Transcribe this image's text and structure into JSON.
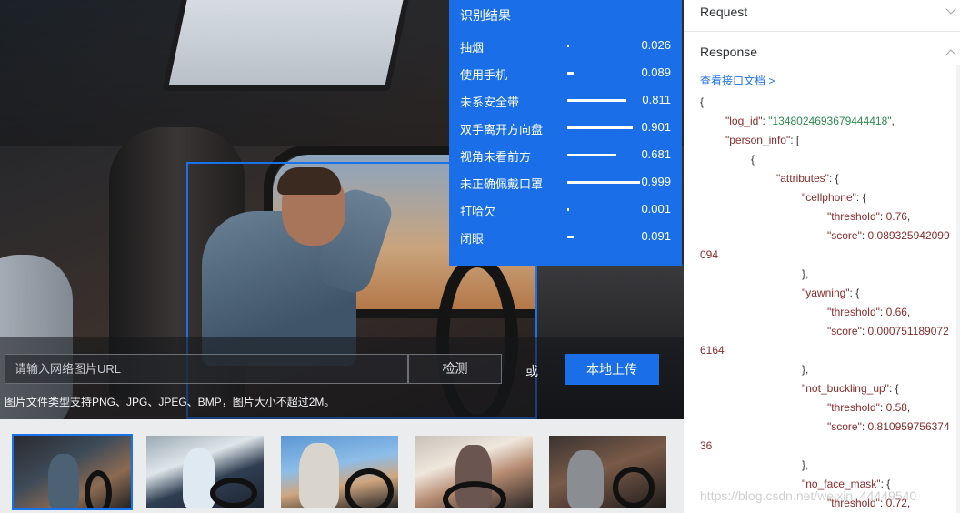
{
  "left": {
    "results": {
      "title": "识别结果",
      "items": [
        {
          "label": "抽烟",
          "value": "0.026",
          "score": 0.026
        },
        {
          "label": "使用手机",
          "value": "0.089",
          "score": 0.089
        },
        {
          "label": "未系安全带",
          "value": "0.811",
          "score": 0.811
        },
        {
          "label": "双手离开方向盘",
          "value": "0.901",
          "score": 0.901
        },
        {
          "label": "视角未看前方",
          "value": "0.681",
          "score": 0.681
        },
        {
          "label": "未正确佩戴口罩",
          "value": "0.999",
          "score": 0.999
        },
        {
          "label": "打哈欠",
          "value": "0.001",
          "score": 0.001
        },
        {
          "label": "闭眼",
          "value": "0.091",
          "score": 0.091
        }
      ]
    },
    "url_input_placeholder": "请输入网络图片URL",
    "detect_label": "检测",
    "or_label": "或",
    "upload_label": "本地上传",
    "hint": "图片文件类型支持PNG、JPG、JPEG、BMP，图片大小不超过2M。",
    "thumbnails": [
      {
        "selected": true
      },
      {
        "selected": false
      },
      {
        "selected": false
      },
      {
        "selected": false
      },
      {
        "selected": false
      }
    ]
  },
  "right": {
    "request_label": "Request",
    "response_label": "Response",
    "doc_link": "查看接口文档 >",
    "json_lines": [
      {
        "indent": 0,
        "parts": [
          {
            "t": "p",
            "v": "{"
          }
        ]
      },
      {
        "indent": 1,
        "parts": [
          {
            "t": "k",
            "v": "\"log_id\""
          },
          {
            "t": "p",
            "v": ": "
          },
          {
            "t": "s",
            "v": "\"1348024693679444418\""
          },
          {
            "t": "p",
            "v": ","
          }
        ]
      },
      {
        "indent": 1,
        "parts": [
          {
            "t": "k",
            "v": "\"person_info\""
          },
          {
            "t": "p",
            "v": ": ["
          }
        ]
      },
      {
        "indent": 2,
        "parts": [
          {
            "t": "p",
            "v": "{"
          }
        ]
      },
      {
        "indent": 3,
        "parts": [
          {
            "t": "k",
            "v": "\"attributes\""
          },
          {
            "t": "p",
            "v": ": {"
          }
        ]
      },
      {
        "indent": 4,
        "parts": [
          {
            "t": "k",
            "v": "\"cellphone\""
          },
          {
            "t": "p",
            "v": ": {"
          }
        ]
      },
      {
        "indent": 5,
        "parts": [
          {
            "t": "k",
            "v": "\"threshold\""
          },
          {
            "t": "p",
            "v": ": "
          },
          {
            "t": "n",
            "v": "0.76"
          },
          {
            "t": "p",
            "v": ","
          }
        ]
      },
      {
        "indent": 5,
        "parts": [
          {
            "t": "k",
            "v": "\"score\""
          },
          {
            "t": "p",
            "v": ": "
          },
          {
            "t": "n",
            "v": "0.089325942099"
          }
        ]
      },
      {
        "indent": 0,
        "parts": [
          {
            "t": "n",
            "v": "094"
          }
        ]
      },
      {
        "indent": 4,
        "parts": [
          {
            "t": "p",
            "v": "},"
          }
        ]
      },
      {
        "indent": 4,
        "parts": [
          {
            "t": "k",
            "v": "\"yawning\""
          },
          {
            "t": "p",
            "v": ": {"
          }
        ]
      },
      {
        "indent": 5,
        "parts": [
          {
            "t": "k",
            "v": "\"threshold\""
          },
          {
            "t": "p",
            "v": ": "
          },
          {
            "t": "n",
            "v": "0.66"
          },
          {
            "t": "p",
            "v": ","
          }
        ]
      },
      {
        "indent": 5,
        "parts": [
          {
            "t": "k",
            "v": "\"score\""
          },
          {
            "t": "p",
            "v": ": "
          },
          {
            "t": "n",
            "v": "0.000751189072"
          }
        ]
      },
      {
        "indent": 0,
        "parts": [
          {
            "t": "n",
            "v": "6164"
          }
        ]
      },
      {
        "indent": 4,
        "parts": [
          {
            "t": "p",
            "v": "},"
          }
        ]
      },
      {
        "indent": 4,
        "parts": [
          {
            "t": "k",
            "v": "\"not_buckling_up\""
          },
          {
            "t": "p",
            "v": ": {"
          }
        ]
      },
      {
        "indent": 5,
        "parts": [
          {
            "t": "k",
            "v": "\"threshold\""
          },
          {
            "t": "p",
            "v": ": "
          },
          {
            "t": "n",
            "v": "0.58"
          },
          {
            "t": "p",
            "v": ","
          }
        ]
      },
      {
        "indent": 5,
        "parts": [
          {
            "t": "k",
            "v": "\"score\""
          },
          {
            "t": "p",
            "v": ": "
          },
          {
            "t": "n",
            "v": "0.810959756374"
          }
        ]
      },
      {
        "indent": 0,
        "parts": [
          {
            "t": "n",
            "v": "36"
          }
        ]
      },
      {
        "indent": 4,
        "parts": [
          {
            "t": "p",
            "v": "},"
          }
        ]
      },
      {
        "indent": 4,
        "parts": [
          {
            "t": "k",
            "v": "\"no_face_mask\""
          },
          {
            "t": "p",
            "v": ": {"
          }
        ]
      },
      {
        "indent": 5,
        "parts": [
          {
            "t": "k",
            "v": "\"threshold\""
          },
          {
            "t": "p",
            "v": ": "
          },
          {
            "t": "n",
            "v": "0.72"
          },
          {
            "t": "p",
            "v": ","
          }
        ]
      }
    ]
  },
  "watermark": "https://blog.csdn.net/weixin_44449540",
  "colors": {
    "accent": "#1a6fe8",
    "json_key": "#8b2b2b",
    "json_string": "#2a8a4a"
  }
}
